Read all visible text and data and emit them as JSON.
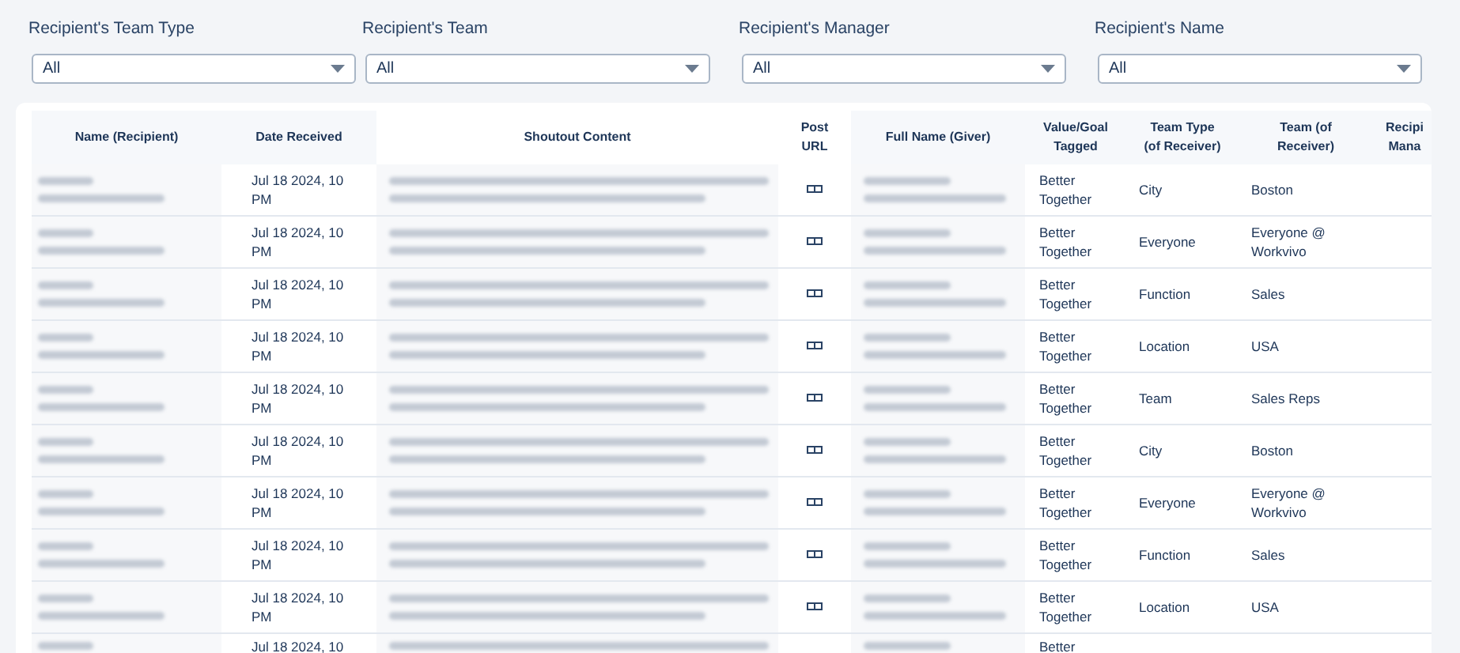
{
  "filters": [
    {
      "label": "Recipient's Team Type",
      "value": "All"
    },
    {
      "label": "Recipient's Team",
      "value": "All"
    },
    {
      "label": "Recipient's Manager",
      "value": "All"
    },
    {
      "label": "Recipient's Name",
      "value": "All"
    }
  ],
  "table": {
    "columns": [
      [
        "Name (Recipient)"
      ],
      [
        "Date Received"
      ],
      [
        "Shoutout Content"
      ],
      [
        "Post",
        "URL"
      ],
      [
        "Full Name (Giver)"
      ],
      [
        "Value/Goal",
        "Tagged"
      ],
      [
        "Team Type",
        "(of Receiver)"
      ],
      [
        "Team (of",
        "Receiver)"
      ],
      [
        "Recipi",
        "Mana"
      ]
    ],
    "rows": [
      {
        "date": [
          "Jul 18 2024, 10",
          "PM"
        ],
        "value": [
          "Better",
          "Together"
        ],
        "team_type": "City",
        "team": [
          "Boston"
        ]
      },
      {
        "date": [
          "Jul 18 2024, 10",
          "PM"
        ],
        "value": [
          "Better",
          "Together"
        ],
        "team_type": "Everyone",
        "team": [
          "Everyone @",
          "Workvivo"
        ]
      },
      {
        "date": [
          "Jul 18 2024, 10",
          "PM"
        ],
        "value": [
          "Better",
          "Together"
        ],
        "team_type": "Function",
        "team": [
          "Sales"
        ]
      },
      {
        "date": [
          "Jul 18 2024, 10",
          "PM"
        ],
        "value": [
          "Better",
          "Together"
        ],
        "team_type": "Location",
        "team": [
          "USA"
        ]
      },
      {
        "date": [
          "Jul 18 2024, 10",
          "PM"
        ],
        "value": [
          "Better",
          "Together"
        ],
        "team_type": "Team",
        "team": [
          "Sales Reps"
        ]
      },
      {
        "date": [
          "Jul 18 2024, 10",
          "PM"
        ],
        "value": [
          "Better",
          "Together"
        ],
        "team_type": "City",
        "team": [
          "Boston"
        ]
      },
      {
        "date": [
          "Jul 18 2024, 10",
          "PM"
        ],
        "value": [
          "Better",
          "Together"
        ],
        "team_type": "Everyone",
        "team": [
          "Everyone @",
          "Workvivo"
        ]
      },
      {
        "date": [
          "Jul 18 2024, 10",
          "PM"
        ],
        "value": [
          "Better",
          "Together"
        ],
        "team_type": "Function",
        "team": [
          "Sales"
        ]
      },
      {
        "date": [
          "Jul 18 2024, 10",
          "PM"
        ],
        "value": [
          "Better",
          "Together"
        ],
        "team_type": "Location",
        "team": [
          "USA"
        ]
      },
      {
        "date": [
          "Jul 18 2024, 10"
        ],
        "value": [
          "Better"
        ],
        "team_type": "",
        "team": []
      }
    ]
  }
}
